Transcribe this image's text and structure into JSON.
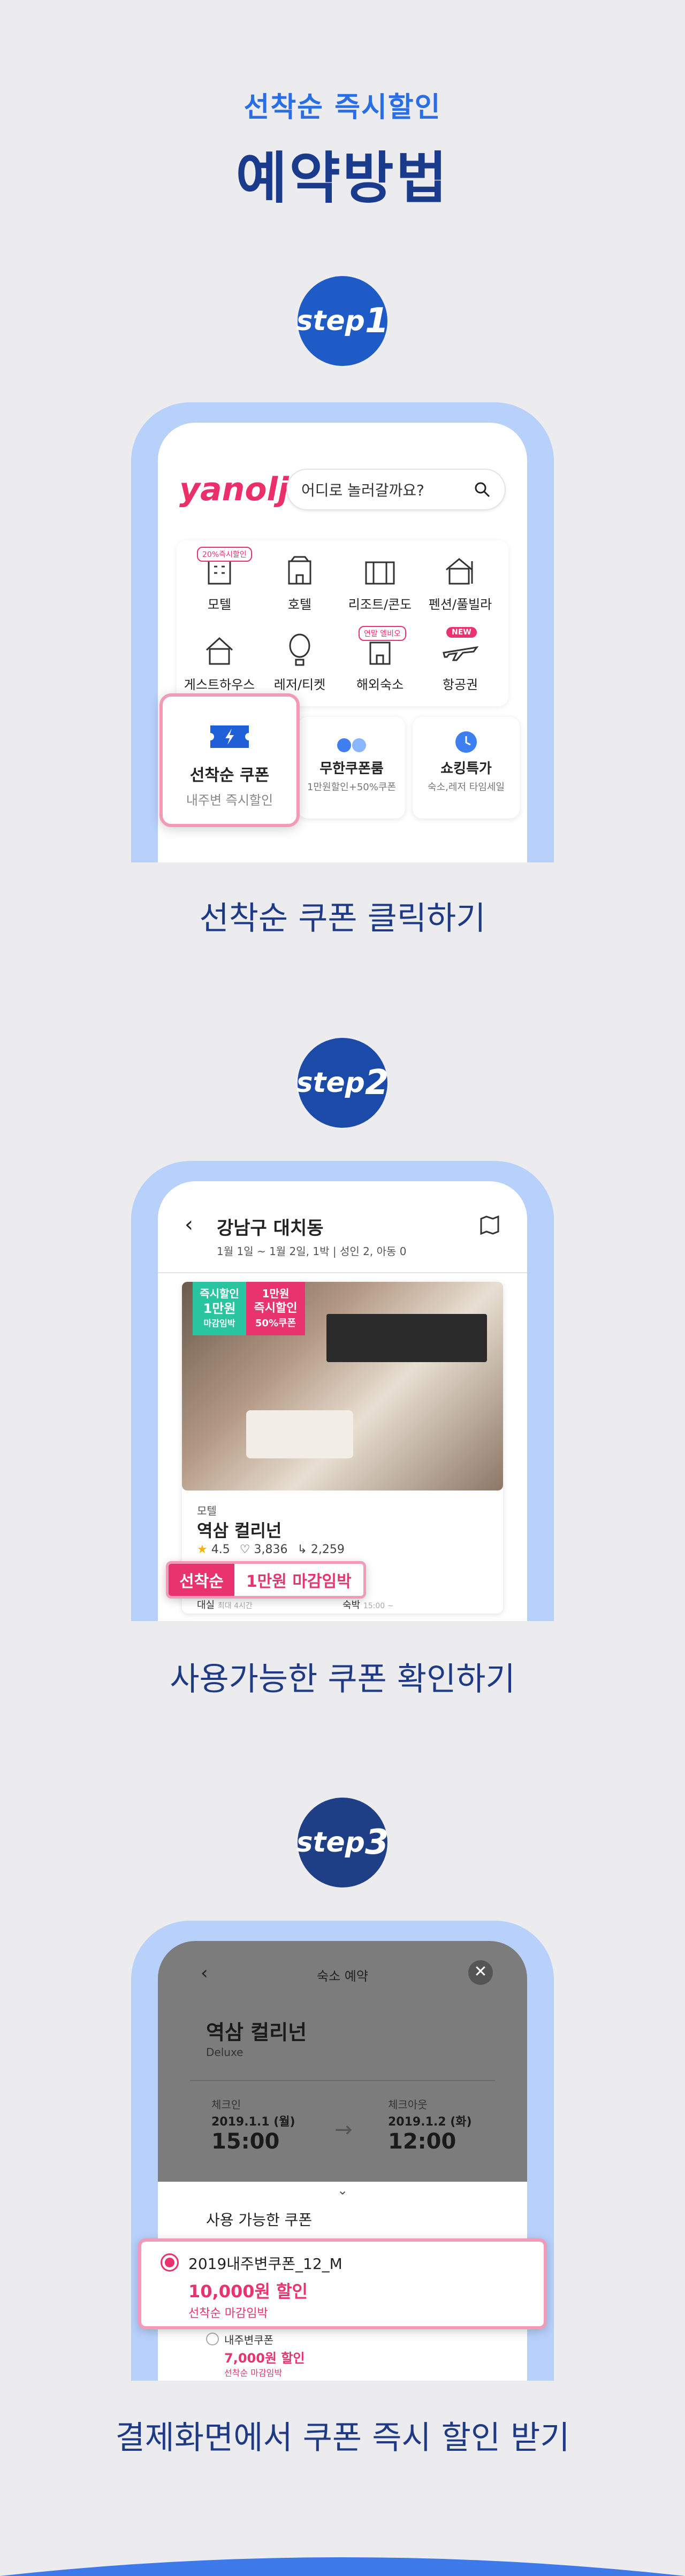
{
  "header": {
    "subtitle": "선착순 즉시할인",
    "title": "예약방법"
  },
  "steps": [
    {
      "label": "step",
      "num": "1",
      "caption": "선착순 쿠폰 클릭하기",
      "color": "#1e5bc6"
    },
    {
      "label": "step",
      "num": "2",
      "caption": "사용가능한 쿠폰 확인하기",
      "color": "#1c4aa8"
    },
    {
      "label": "step",
      "num": "3",
      "caption": "결제화면에서 쿠폰 즉시 할인 받기",
      "color": "#1e3f86"
    }
  ],
  "s1": {
    "logo": "yanolja",
    "search_placeholder": "어디로 놀러갈까요?",
    "categories": [
      {
        "label": "모텔",
        "badge": "20%즉시할인",
        "icon": "motel-icon"
      },
      {
        "label": "호텔",
        "icon": "hotel-icon"
      },
      {
        "label": "리조트/콘도",
        "icon": "resort-icon"
      },
      {
        "label": "펜션/풀빌라",
        "icon": "pension-icon"
      },
      {
        "label": "게스트하우스",
        "icon": "guesthouse-icon"
      },
      {
        "label": "레저/티켓",
        "icon": "balloon-icon"
      },
      {
        "label": "해외숙소",
        "badge": "연말 엘비오",
        "icon": "overseas-icon"
      },
      {
        "label": "항공권",
        "badge_new": "NEW",
        "icon": "airplane-icon"
      }
    ],
    "coupon_card": {
      "title": "선착순 쿠폰",
      "sub": "내주변 즉시할인"
    },
    "infinite_card": {
      "title": "무한쿠폰룸",
      "sub": "1만원할인+50%쿠폰"
    },
    "shocking_card": {
      "title": "쇼킹특가",
      "sub": "숙소,레저 타임세일"
    }
  },
  "s2": {
    "location": "강남구 대치동",
    "dates": "1월 1일 ~ 1월 2일, 1박 | 성인 2, 아동 0",
    "tag_green": [
      "즉시할인",
      "1만원",
      "마감임박"
    ],
    "tag_pink": [
      "1만원",
      "즉시할인",
      "50%쿠폰"
    ],
    "category": "모텔",
    "hotel_name": "역삼 컬리넌",
    "rating": "4.5",
    "reviews": "3,836",
    "likes": "2,259",
    "coupon_label": "선착순",
    "coupon_value": "1만원 마감임박",
    "rent_label": "대실",
    "rent_sub": "최대 4시간",
    "stay_label": "숙박",
    "stay_sub": "15:00 ~"
  },
  "s3": {
    "header_title": "숙소 예약",
    "hotel_name": "역삼 컬리넌",
    "room": "Deluxe",
    "checkin_label": "체크인",
    "checkin_date": "2019.1.1 (월)",
    "checkin_time": "15:00",
    "checkout_label": "체크아웃",
    "checkout_date": "2019.1.2 (화)",
    "checkout_time": "12:00",
    "coupons_title": "사용 가능한 쿠폰",
    "coupon1_name": "2019내주변쿠폰_12_M",
    "coupon1_amount": "10,000원 할인",
    "coupon1_note": "선착순 마감임박",
    "coupon2_name": "내주변쿠폰",
    "coupon2_amount": "7,000원 할인",
    "coupon2_note": "선착순 마감임박"
  }
}
